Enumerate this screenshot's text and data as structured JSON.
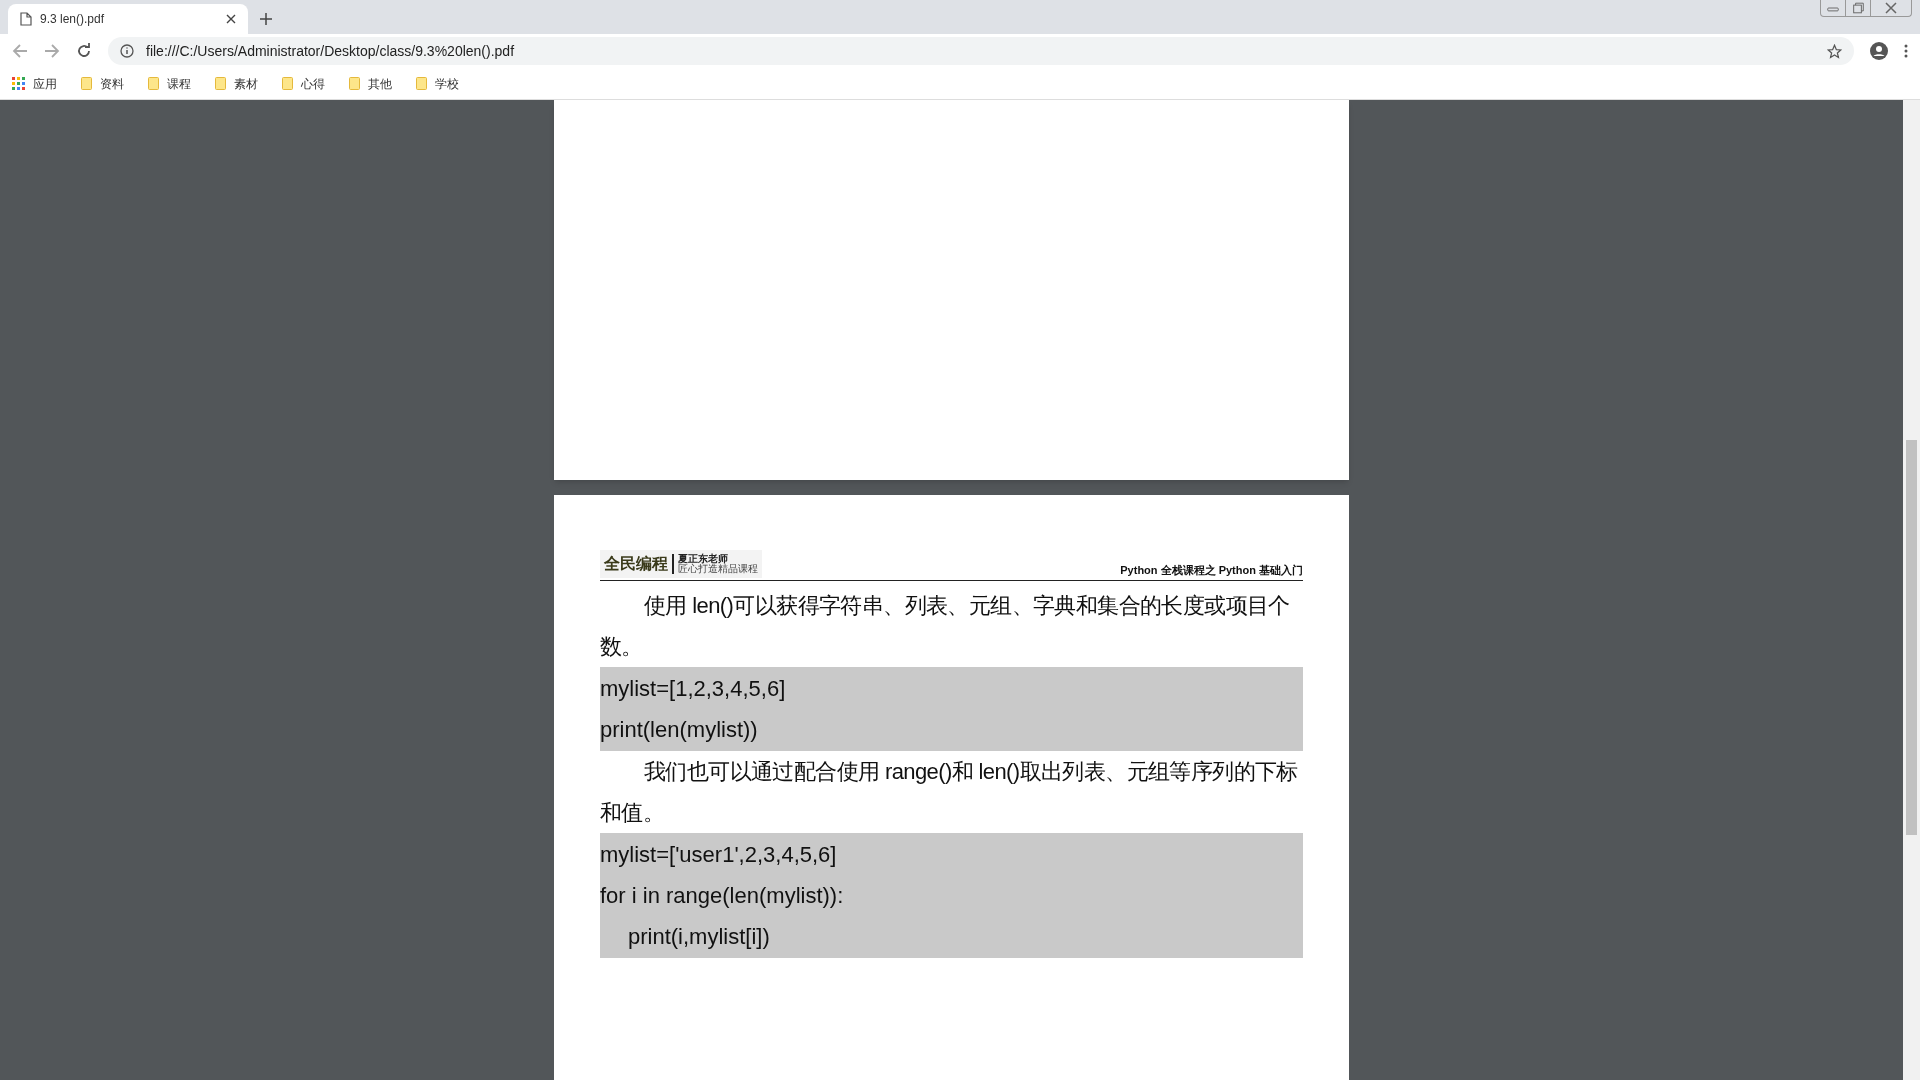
{
  "browser": {
    "tab": {
      "title": "9.3 len().pdf"
    },
    "address": {
      "url": "file:///C:/Users/Administrator/Desktop/class/9.3%20len().pdf"
    },
    "apps_label": "应用",
    "bookmarks": [
      "资料",
      "课程",
      "素材",
      "心得",
      "其他",
      "学校"
    ]
  },
  "document": {
    "header": {
      "logo_title": "全民编程",
      "logo_name": "夏正东",
      "logo_name_suffix": "老师",
      "logo_slogan": "匠心打造精品课程",
      "course_title": "Python 全栈课程之 Python 基础入门"
    },
    "blocks": [
      {
        "kind": "paragraph",
        "text": "使用 len()可以获得字符串、列表、元组、字典和集合的长度或项目个数。"
      },
      {
        "kind": "code",
        "lines": [
          {
            "text": "mylist=[1,2,3,4,5,6]",
            "indented": false
          },
          {
            "text": "print(len(mylist))",
            "indented": false
          }
        ]
      },
      {
        "kind": "paragraph",
        "text": "我们也可以通过配合使用 range()和 len()取出列表、元组等序列的下标和值。"
      },
      {
        "kind": "code",
        "lines": [
          {
            "text": "mylist=['user1',2,3,4,5,6]",
            "indented": false
          },
          {
            "text": "for i in range(len(mylist)):",
            "indented": false
          },
          {
            "text": "print(i,mylist[i])",
            "indented": true
          }
        ]
      }
    ]
  }
}
